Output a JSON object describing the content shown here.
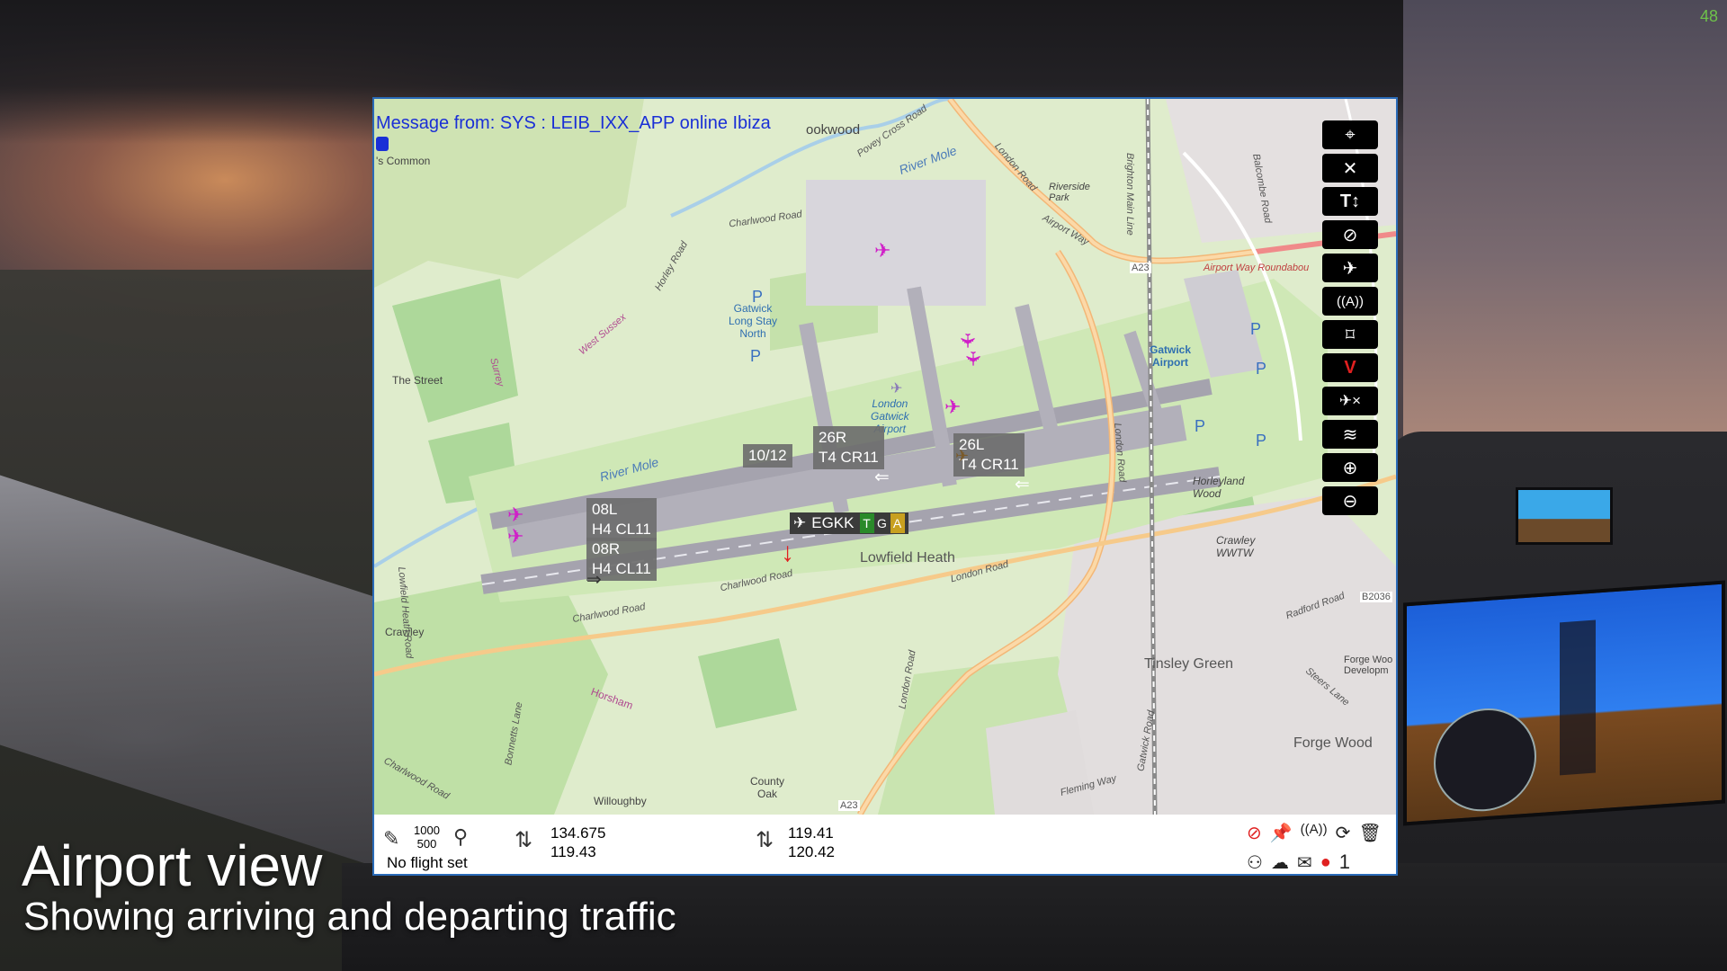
{
  "caption": {
    "title": "Airport view",
    "subtitle": "Showing arriving and departing traffic"
  },
  "overlay": {
    "fps": "48"
  },
  "app": {
    "message": "Message from: SYS : LEIB_IXX_APP online Ibiza",
    "toolbar": [
      {
        "name": "center-icon",
        "glyph": "⌖"
      },
      {
        "name": "close-icon",
        "glyph": "✕"
      },
      {
        "name": "text-size-icon",
        "glyph": "T↕"
      },
      {
        "name": "hide-traffic-icon",
        "glyph": "⊘"
      },
      {
        "name": "departure-icon",
        "glyph": "✈"
      },
      {
        "name": "atc-tower-icon",
        "glyph": "((A))"
      },
      {
        "name": "waypoint-icon",
        "glyph": "⌑"
      },
      {
        "name": "vor-icon",
        "glyph": "V"
      },
      {
        "name": "remove-aircraft-icon",
        "glyph": "✈×"
      },
      {
        "name": "layers-icon",
        "glyph": "≋"
      },
      {
        "name": "zoom-in-icon",
        "glyph": "⊕"
      },
      {
        "name": "zoom-out-icon",
        "glyph": "⊖"
      }
    ],
    "map": {
      "place_labels": {
        "commons": "'s Common",
        "gatwick_long_stay": "Gatwick\nLong Stay\nNorth",
        "london_gatwick": "London\nGatwick\nAirport",
        "gatwick_airport": "Gatwick\nAirport",
        "lowfield_heath": "Lowfield Heath",
        "tinsley_green": "Tinsley Green",
        "forge_wood": "Forge Wood",
        "horleyland_wood": "Horleyland\nWood",
        "crawley_wwtw": "Crawley\nWWTW",
        "crawley": "Crawley",
        "horsham": "Horsham",
        "county_oak": "County\nOak",
        "the_street": "The Street",
        "riverside_park": "Riverside\nPark",
        "forge_wood_dev": "Forge Woo\nDevelopm",
        "willoughby": "Willoughby",
        "brookwood": "ookwood"
      },
      "road_labels": {
        "charlwood_road_n": "Charlwood Road",
        "horley_road": "Horley Road",
        "povey_cross": "Povey Cross Road",
        "river_mole": "River Mole",
        "river_mole_2": "River Mole",
        "london_road_n": "London Road",
        "airport_way": "Airport Way",
        "a23_n": "A23",
        "airport_way_roundabout": "Airport Way Roundabou",
        "brighton_main_line": "Brighton Main Line",
        "balcombe_road": "Balcombe Road",
        "london_road_e": "London Road",
        "charlwood_road_s": "Charlwood Road",
        "charlwood_road_s2": "Charlwood Road",
        "london_road_s": "London Road",
        "london_road_s2": "London Road",
        "radford_road": "Radford Road",
        "b2036": "B2036",
        "steers_lane": "Steers Lane",
        "gatwick_road": "Gatwick Road",
        "fleming_way": "Fleming Way",
        "a23_s": "A23",
        "bonnetts_lane": "Bonnetts Lane",
        "lowfield_heath_road": "Lowfield Heath Road",
        "charlwood_road_sw": "Charlwood Road",
        "west_sussex": "West Sussex",
        "surrey": "Surrey"
      },
      "runway_labels": [
        {
          "id": "rwy-10-12",
          "line1": "10/12",
          "line2": ""
        },
        {
          "id": "rwy-26r",
          "line1": "26R",
          "line2": "T4 CR11"
        },
        {
          "id": "rwy-26l",
          "line1": "26L",
          "line2": "T4 CR11"
        },
        {
          "id": "rwy-08l",
          "line1": "08L",
          "line2": "H4 CL11"
        },
        {
          "id": "rwy-08r",
          "line1": "08R",
          "line2": "H4 CL11"
        }
      ],
      "airport_tag": {
        "icao": "EGKK",
        "badges": [
          {
            "letter": "T",
            "color": "#2a8a2a"
          },
          {
            "letter": "G",
            "color": "#3a3a3a"
          },
          {
            "letter": "A",
            "color": "#c8a020"
          }
        ]
      }
    },
    "statusbar": {
      "scale_top": "1000",
      "scale_bottom": "500",
      "flight_plan": "No flight set",
      "com1_active": "134.675",
      "com1_standby": "119.43",
      "com2_active": "119.41",
      "com2_standby": "120.42",
      "notification_count": "1"
    }
  }
}
